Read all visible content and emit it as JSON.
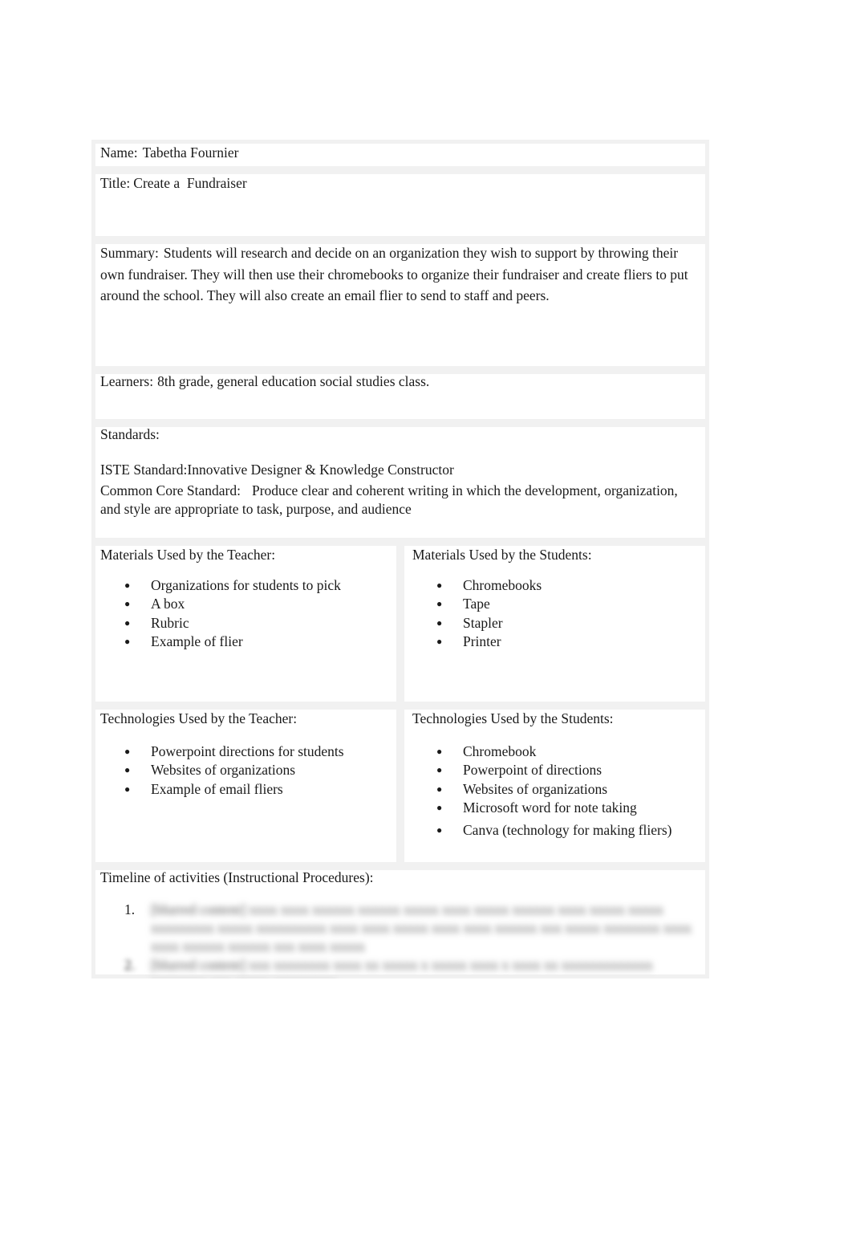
{
  "document": {
    "name": {
      "label": "Name:",
      "value": "Tabetha Fournier"
    },
    "title": {
      "label": "Title:",
      "value": "Create a  Fundraiser"
    },
    "summary": {
      "label": "Summary:",
      "value": "Students will research and decide on an organization they wish to support by throwing their own fundraiser. They will then use their chromebooks to organize their fundraiser and create fliers to put around the school. They will also create an email flier to send to staff and peers."
    },
    "learners": {
      "label": "Learners:",
      "value": "8th grade, general education social studies class."
    },
    "standards": {
      "label": "Standards:",
      "iste_label": "ISTE Standard:",
      "iste_value": "Innovative Designer & Knowledge Constructor",
      "common_core_label": "Common Core Standard:",
      "common_core_value": "Produce clear and coherent writing in which the development, organization, and style are appropriate to task, purpose, and audience"
    },
    "materials_teacher": {
      "label": "Materials Used by the Teacher:",
      "items": [
        "Organizations for students to pick",
        "A box",
        "Rubric",
        "Example of flier"
      ]
    },
    "materials_students": {
      "label": "Materials Used by the Students:",
      "items": [
        "Chromebooks",
        "Tape",
        "Stapler",
        "Printer"
      ]
    },
    "tech_teacher": {
      "label": "Technologies Used by the Teacher:",
      "items": [
        "Powerpoint directions for students",
        "Websites of organizations",
        "Example of email fliers"
      ]
    },
    "tech_students": {
      "label": "Technologies Used by the Students:",
      "items": [
        "Chromebook",
        "Powerpoint of directions",
        "Websites of organizations",
        "Microsoft word for note taking",
        "Canva (technology for making fliers)"
      ]
    },
    "timeline": {
      "label": "Timeline of activities (Instructional Procedures):",
      "items": [
        {
          "num": "1.",
          "text": "[blurred content] xxxx xxxx xxxxxx xxxxxx xxxxx xxxx xxxxx xxxxxx xxxx xxxxx xxxxx xxxxxxxxx xxxxx xxxxxxxxxx xxxx xxxx xxxxx xxxx xxxx xxxxxx xxx xxxxx xxxxxxxx xxxx xxxx xxxxxx xxxxxx xxx xxxx xxxxx"
        },
        {
          "num": "2.",
          "text": "[blurred content] xxx xxxxxxxx xxxx xx xxxxx x xxxxx xxxx x xxxx xx xxxxxxxxxxxxx xxxxxxxx xxx xxxxx xxxxxxxxx"
        }
      ]
    }
  }
}
